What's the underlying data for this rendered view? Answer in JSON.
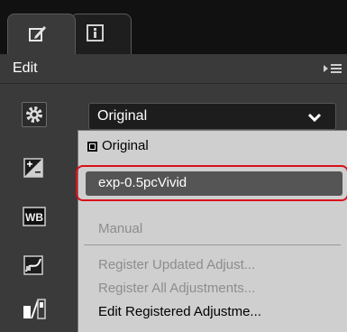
{
  "tabs": {
    "edit_icon": "pencil-edit-icon",
    "info_icon": "info-icon"
  },
  "header": {
    "title": "Edit",
    "menu_icon": "panel-menu-icon"
  },
  "tools": [
    {
      "name": "settings-icon"
    },
    {
      "name": "exposure-compensation-icon"
    },
    {
      "name": "white-balance-icon",
      "text": "WB"
    },
    {
      "name": "tone-curve-icon"
    },
    {
      "name": "levels-icon"
    }
  ],
  "preset": {
    "selected": "Original"
  },
  "dropdown": {
    "items": [
      {
        "label": "Original",
        "state": "checked"
      },
      {
        "label": "exp-0.5pcVivid",
        "state": "highlighted"
      },
      {
        "label": "Manual",
        "state": "disabled"
      },
      {
        "label": "Register Updated Adjust...",
        "state": "disabled"
      },
      {
        "label": "Register All Adjustments...",
        "state": "disabled"
      },
      {
        "label": "Edit Registered Adjustme...",
        "state": "enabled"
      }
    ]
  },
  "colors": {
    "panel_bg": "#3a3a3a",
    "highlight_border": "#d8101a",
    "menu_bg": "#cfcfcf"
  }
}
